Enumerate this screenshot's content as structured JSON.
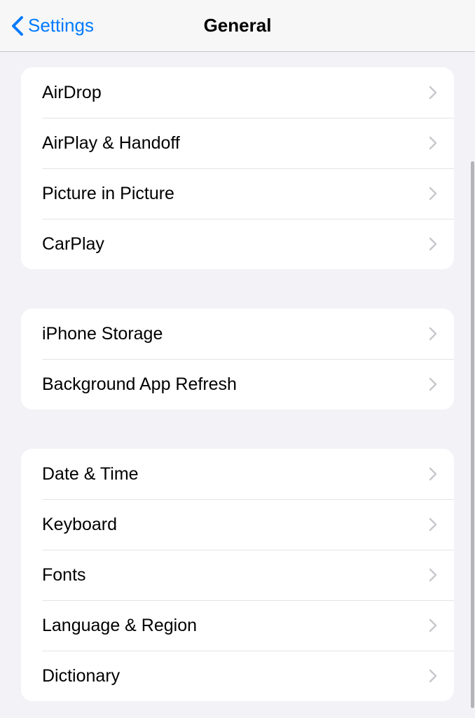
{
  "header": {
    "back_label": "Settings",
    "title": "General"
  },
  "groups": [
    {
      "items": [
        {
          "label": "AirDrop"
        },
        {
          "label": "AirPlay & Handoff"
        },
        {
          "label": "Picture in Picture"
        },
        {
          "label": "CarPlay"
        }
      ]
    },
    {
      "items": [
        {
          "label": "iPhone Storage"
        },
        {
          "label": "Background App Refresh"
        }
      ]
    },
    {
      "items": [
        {
          "label": "Date & Time"
        },
        {
          "label": "Keyboard"
        },
        {
          "label": "Fonts"
        },
        {
          "label": "Language & Region"
        },
        {
          "label": "Dictionary"
        }
      ]
    }
  ]
}
